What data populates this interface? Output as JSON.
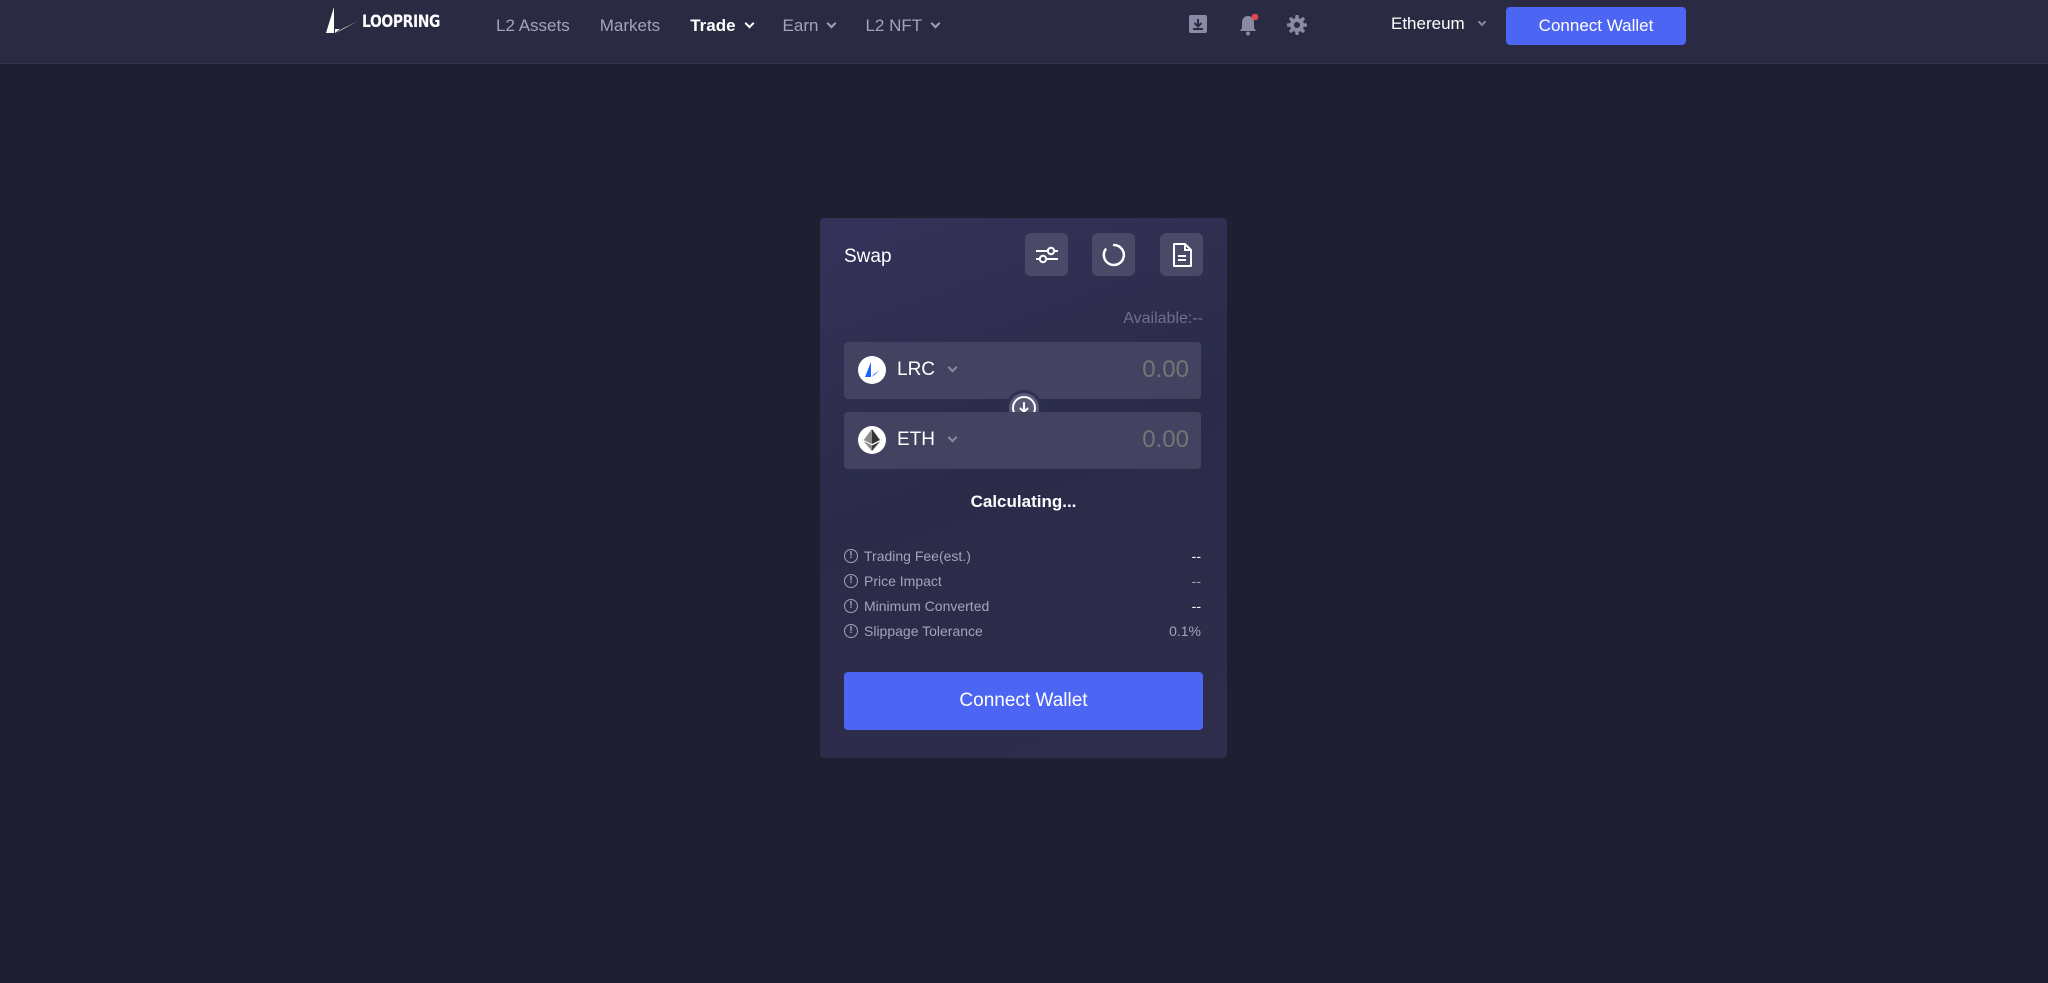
{
  "header": {
    "logo_text": "LOOPRING",
    "nav": [
      {
        "label": "L2 Assets",
        "dropdown": false,
        "active": false
      },
      {
        "label": "Markets",
        "dropdown": false,
        "active": false
      },
      {
        "label": "Trade",
        "dropdown": true,
        "active": true
      },
      {
        "label": "Earn",
        "dropdown": true,
        "active": false
      },
      {
        "label": "L2 NFT",
        "dropdown": true,
        "active": false
      }
    ],
    "icons": [
      "download-icon",
      "bell-icon",
      "gear-icon"
    ],
    "network": "Ethereum",
    "connect_label": "Connect Wallet"
  },
  "swap": {
    "title": "Swap",
    "tools": [
      "slider-settings-icon",
      "refresh-icon",
      "document-icon"
    ],
    "available": "Available:--",
    "from": {
      "token": "LRC",
      "amount_placeholder": "0.00"
    },
    "to": {
      "token": "ETH",
      "amount_placeholder": "0.00"
    },
    "status": "Calculating...",
    "info": [
      {
        "label": "Trading Fee(est.)",
        "value": "--"
      },
      {
        "label": "Price Impact",
        "value": "--"
      },
      {
        "label": "Minimum Converted",
        "value": "--"
      },
      {
        "label": "Slippage Tolerance",
        "value": "0.1%"
      }
    ],
    "connect_label": "Connect Wallet"
  },
  "colors": {
    "page_bg": "#1f1f32",
    "header_bg": "#2a2a43",
    "accent": "#4c65f2",
    "muted_text": "#a3a3bd",
    "notification_dot": "#e5484d"
  }
}
